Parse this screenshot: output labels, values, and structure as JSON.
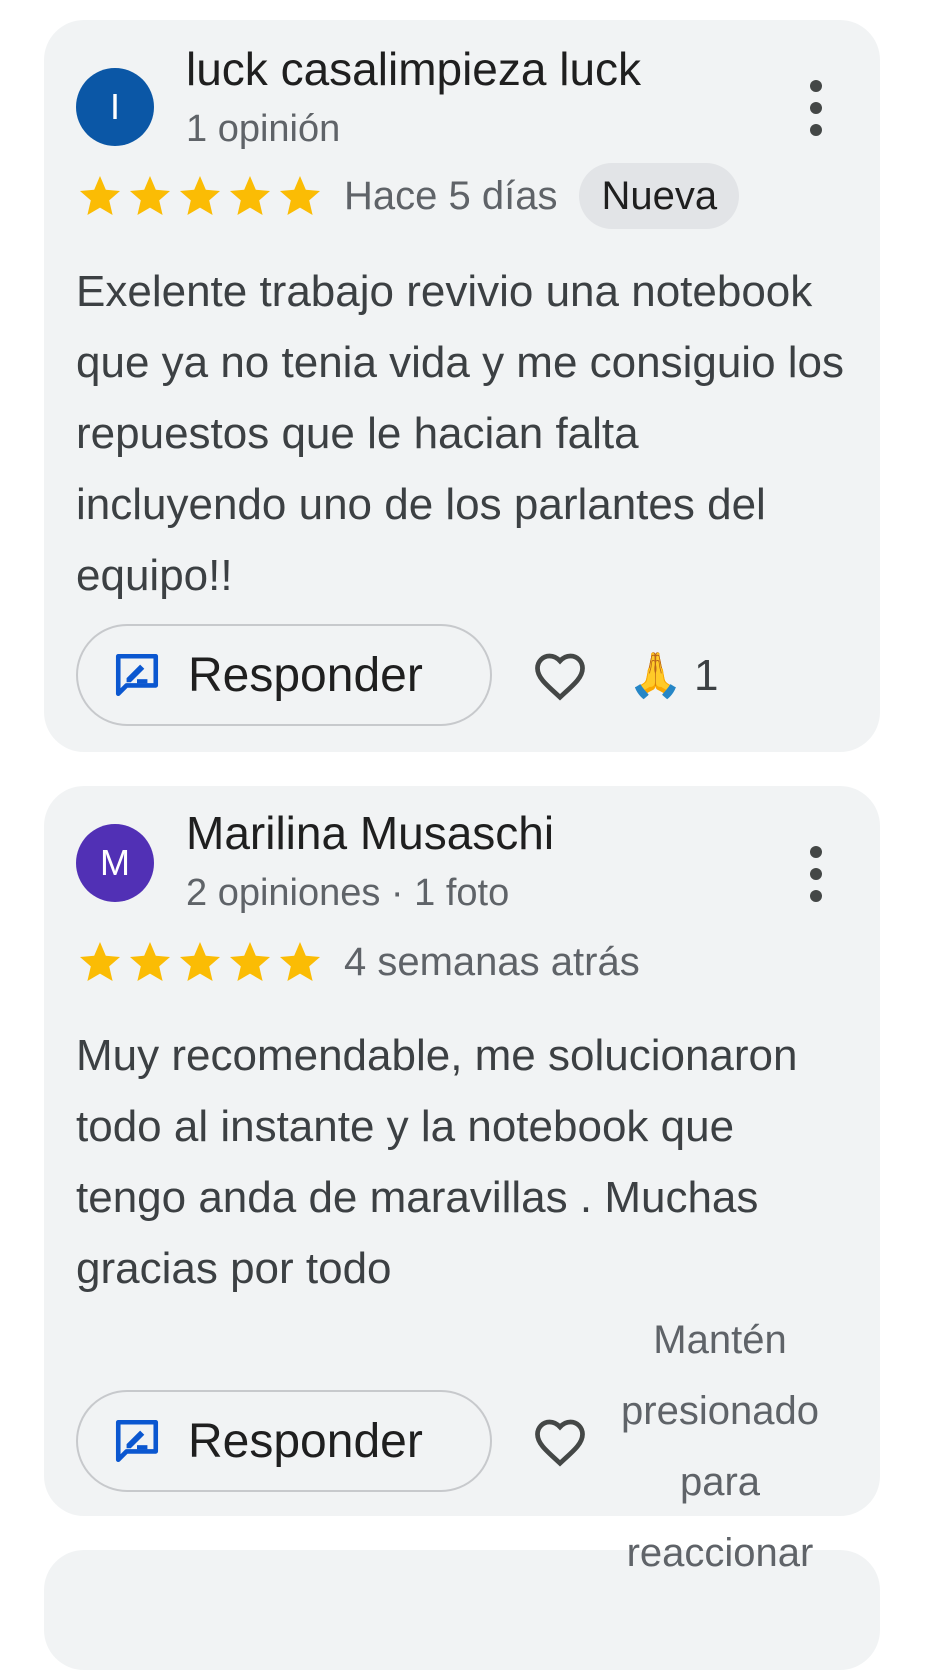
{
  "reviews": [
    {
      "avatar_initial": "I",
      "avatar_color": "#0b57a6",
      "author": "luck casalimpieza luck",
      "author_meta": "1 opinión",
      "rating": 5,
      "time": "Hace 5 días",
      "badge": "Nueva",
      "text": "Exelente trabajo revivio una notebook que ya no tenia vida y me consiguio los repuestos que le hacian falta incluyendo uno de los parlantes del equipo!!",
      "reply_label": "Responder",
      "reaction_emoji": "🙏",
      "reaction_count": "1"
    },
    {
      "avatar_initial": "M",
      "avatar_color": "#5130b5",
      "author": "Marilina Musaschi",
      "author_meta": "2 opiniones · 1 foto",
      "rating": 5,
      "time": "4 semanas atrás",
      "text": "Muy recomendable, me solucionaron todo al instante y la notebook que tengo anda de maravillas . Muchas gracias por todo",
      "reply_label": "Responder"
    }
  ],
  "tooltip": "Mantén presionado para reaccionar",
  "icons": {
    "star": "star-icon",
    "more": "more-vert-icon",
    "reply": "rate-review-icon",
    "like": "heart-outline-icon"
  },
  "colors": {
    "card_bg": "#f1f3f4",
    "star": "#fbbc04",
    "reply_icon": "#0b57d0"
  }
}
